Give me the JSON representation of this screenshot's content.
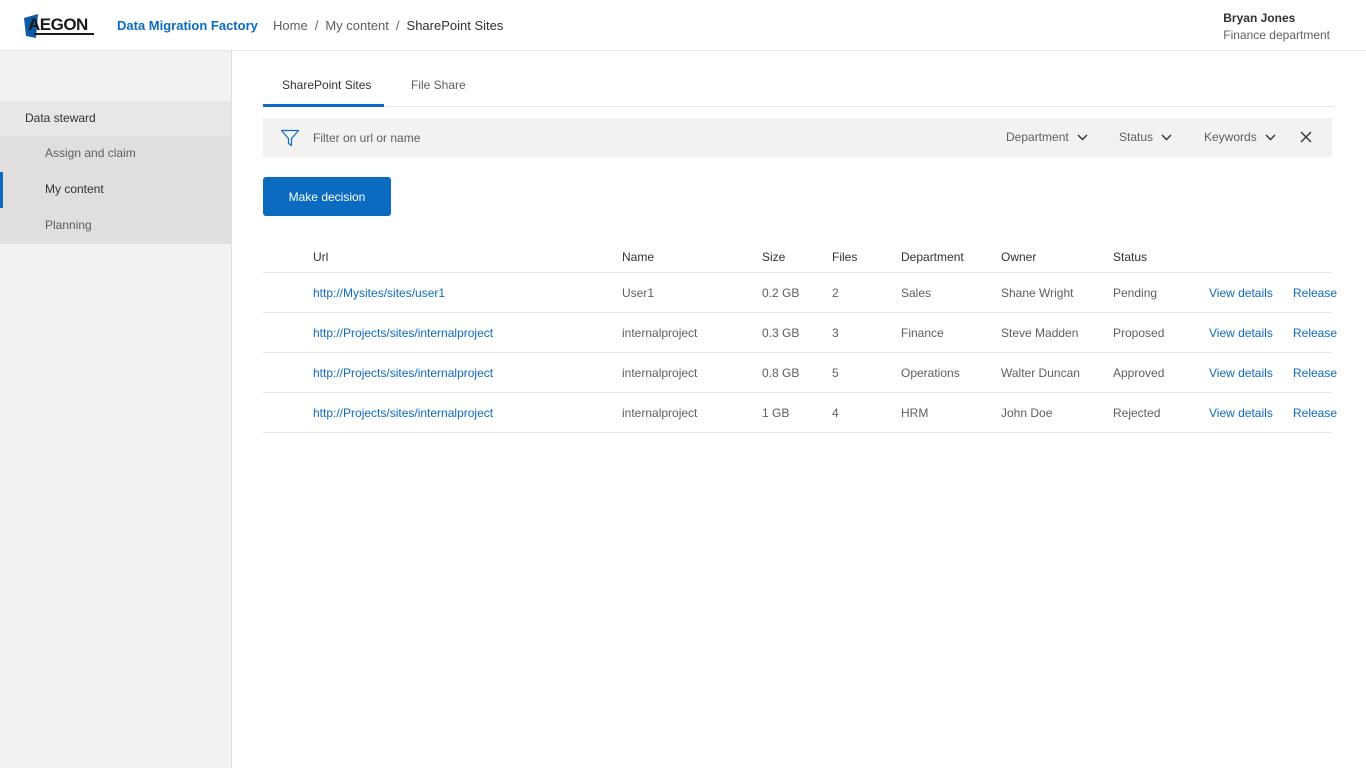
{
  "header": {
    "logo_text": "AEGON",
    "app_title": "Data Migration Factory",
    "breadcrumb": [
      "Home",
      "My content",
      "SharePoint Sites"
    ],
    "user_name": "Bryan Jones",
    "user_department": "Finance department"
  },
  "sidebar": {
    "group_label": "Data steward",
    "items": [
      {
        "label": "Assign and claim"
      },
      {
        "label": "My content"
      },
      {
        "label": "Planning"
      }
    ]
  },
  "tabs": [
    {
      "label": "SharePoint Sites"
    },
    {
      "label": "File Share"
    }
  ],
  "filter": {
    "placeholder": "Filter on url or name",
    "department_label": "Department",
    "status_label": "Status",
    "keywords_label": "Keywords"
  },
  "actions": {
    "make_decision": "Make decision"
  },
  "table": {
    "headers": {
      "url": "Url",
      "name": "Name",
      "size": "Size",
      "files": "Files",
      "department": "Department",
      "owner": "Owner",
      "status": "Status"
    },
    "rows": [
      {
        "url": "http://Mysites/sites/user1",
        "name": "User1",
        "size": "0.2 GB",
        "files": "2",
        "department": "Sales",
        "owner": "Shane Wright",
        "status": "Pending",
        "view": "View details",
        "release": "Release"
      },
      {
        "url": "http://Projects/sites/internalproject",
        "name": "internalproject",
        "size": "0.3 GB",
        "files": "3",
        "department": "Finance",
        "owner": "Steve Madden",
        "status": "Proposed",
        "view": "View details",
        "release": "Release"
      },
      {
        "url": "http://Projects/sites/internalproject",
        "name": "internalproject",
        "size": "0.8 GB",
        "files": "5",
        "department": "Operations",
        "owner": "Walter Duncan",
        "status": "Approved",
        "view": "View details",
        "release": "Release"
      },
      {
        "url": "http://Projects/sites/internalproject",
        "name": "internalproject",
        "size": "1 GB",
        "files": "4",
        "department": "HRM",
        "owner": "John Doe",
        "status": "Rejected",
        "view": "View details",
        "release": "Release"
      }
    ]
  },
  "colors": {
    "accent": "#0b6bc1"
  }
}
